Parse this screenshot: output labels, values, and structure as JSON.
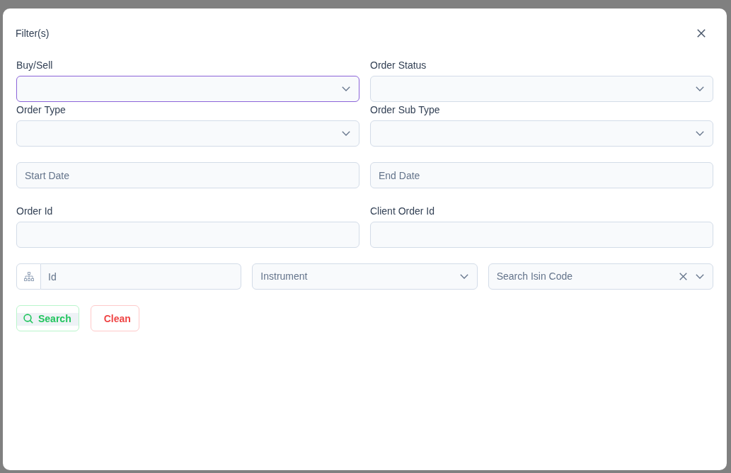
{
  "dialog": {
    "title": "Filter(s)"
  },
  "fields": [
    {
      "kind": "select",
      "label": "Buy/Sell",
      "focused": true
    },
    {
      "kind": "select",
      "label": "Order Status",
      "focused": false
    },
    {
      "kind": "select",
      "label": "Order Type",
      "focused": false
    },
    {
      "kind": "select",
      "label": "Order Sub Type",
      "focused": false
    },
    {
      "kind": "date",
      "placeholder": "Start Date"
    },
    {
      "kind": "date",
      "placeholder": "End Date"
    },
    {
      "kind": "text",
      "label": "Order Id"
    },
    {
      "kind": "text",
      "label": "Client Order Id"
    }
  ],
  "search_row": [
    {
      "kind": "addon_input",
      "placeholder": "Id"
    },
    {
      "kind": "select",
      "placeholder": "Instrument",
      "focused": false,
      "clearable": false
    },
    {
      "kind": "select",
      "placeholder": "Search Isin Code",
      "focused": false,
      "clearable": true
    }
  ],
  "buttons": [
    {
      "kind": "search",
      "label": "Search"
    },
    {
      "kind": "clear",
      "label": "Clean"
    }
  ]
}
